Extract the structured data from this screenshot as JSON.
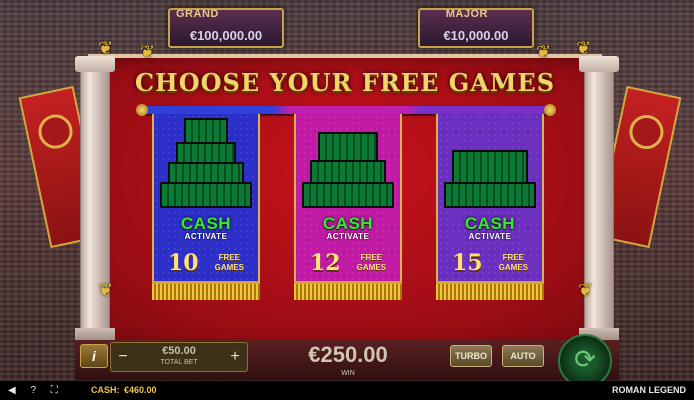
{
  "jackpots": {
    "grand": {
      "label": "GRAND",
      "value": "€100,000.00"
    },
    "major": {
      "label": "MAJOR",
      "value": "€10,000.00"
    }
  },
  "title": "CHOOSE YOUR FREE GAMES",
  "options": [
    {
      "color": "#2b2fc8",
      "feature": "CASH",
      "feature_sub": "ACTIVATE",
      "count": "10",
      "free_line1": "FREE",
      "free_line2": "GAMES"
    },
    {
      "color": "#c01aa4",
      "feature": "CASH",
      "feature_sub": "ACTIVATE",
      "count": "12",
      "free_line1": "FREE",
      "free_line2": "GAMES"
    },
    {
      "color": "#6b2fc0",
      "feature": "CASH",
      "feature_sub": "ACTIVATE",
      "count": "15",
      "free_line1": "FREE",
      "free_line2": "GAMES"
    }
  ],
  "controls": {
    "info_icon": "info-icon",
    "info_label": "i",
    "minus_label": "−",
    "plus_label": "+",
    "total_bet_value": "€50.00",
    "total_bet_label": "TOTAL BET",
    "win_value": "€250.00",
    "win_label": "WIN",
    "turbo_label": "TURBO",
    "auto_label": "AUTO",
    "spin_icon": "spin-icon",
    "spin_glyph": "⟳"
  },
  "footer": {
    "icons": "◀ ? ⛶",
    "cash_label": "CASH:",
    "cash_value": "€460.00",
    "game_name": "ROMAN LEGEND"
  }
}
